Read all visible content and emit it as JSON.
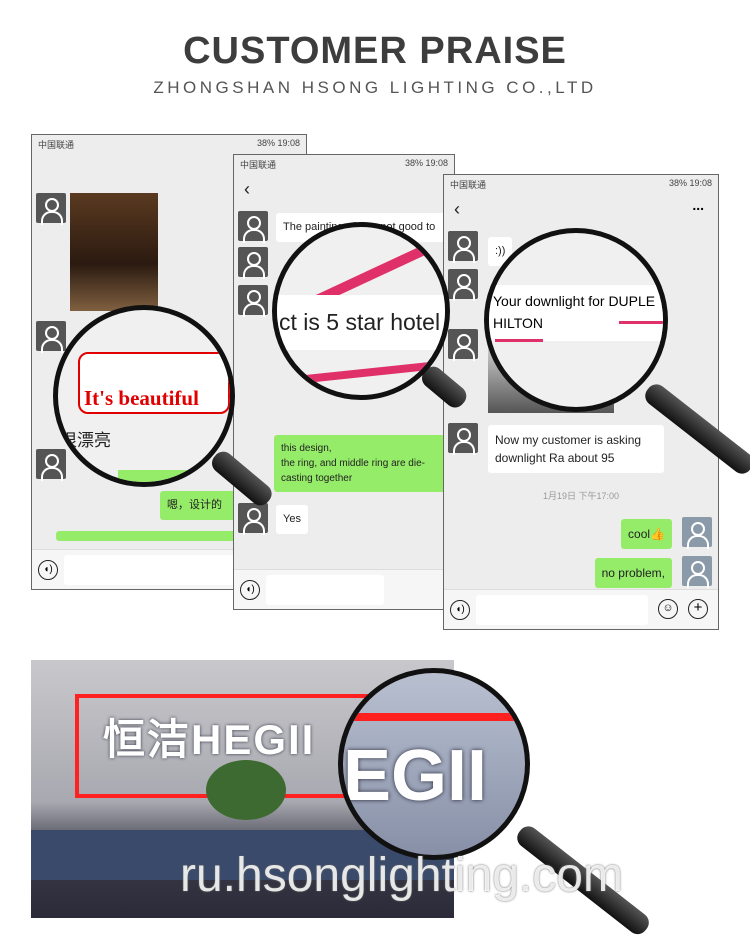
{
  "header": {
    "title": "CUSTOMER PRAISE",
    "subtitle": "ZHONGSHAN HSONG LIGHTING CO.,LTD"
  },
  "status": {
    "carrier": "中国联通",
    "battery": "38%",
    "time": "19:08"
  },
  "phone1": {
    "messages": [
      "嗯，设计的"
    ],
    "magnified": {
      "callout": "It's beautiful",
      "chinese": "很漂亮"
    }
  },
  "phone2": {
    "messages": [
      "The painting of ring not good to",
      "this design,\nthe ring, and middle ring are die-casting together",
      "Yes"
    ],
    "magnified": {
      "text": "ct is 5 star hotel"
    }
  },
  "phone3": {
    "more": "...",
    "messages": [
      ":))",
      "Now my customer is asking downlight Ra about 95",
      "cool👍",
      "no problem,"
    ],
    "timestamp": "1月19日 下午17:00",
    "magnified": {
      "line1": "Your downlight for DUPLE",
      "line2": "HILTON"
    }
  },
  "photo": {
    "sign": "恒洁HEGII",
    "magnified": "EGII"
  },
  "watermark": "ru.hsonglighting.com",
  "colors": {
    "bubble_green": "#95ec69",
    "highlight": "#e0306a",
    "callout_red": "#e00000"
  }
}
